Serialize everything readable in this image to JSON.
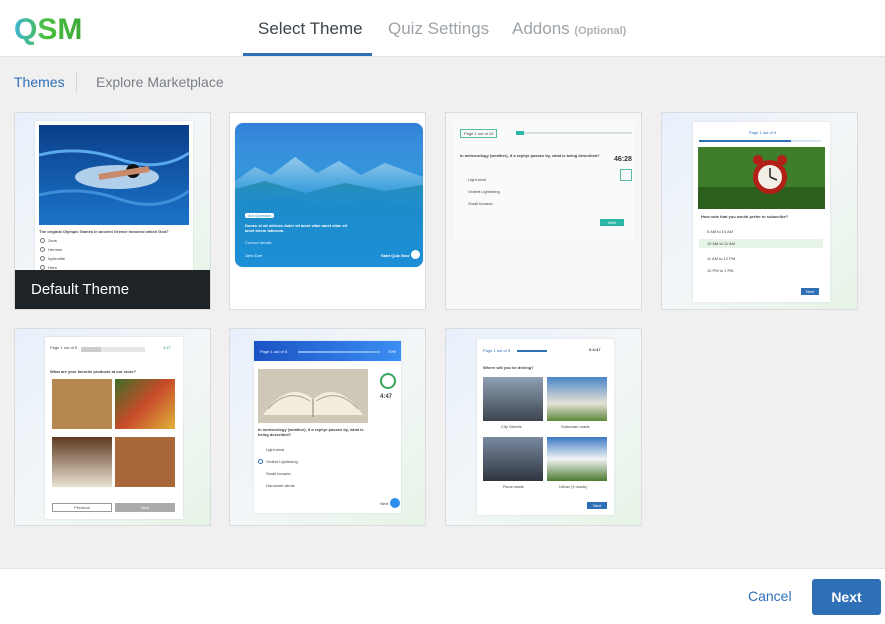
{
  "header": {
    "logo_text": "QSM",
    "steps": [
      {
        "label": "Select Theme"
      },
      {
        "label": "Quiz Settings"
      },
      {
        "label": "Addons",
        "suffix": "(Optional)"
      }
    ]
  },
  "subnav": {
    "tabs": [
      {
        "label": "Themes"
      },
      {
        "label": "Explore Marketplace"
      }
    ]
  },
  "themes": [
    {
      "label": "Default Theme",
      "question": "The original Olympic Games in ancient Greece honored which God?",
      "options": [
        "Zeus",
        "Hermes",
        "Aphrodite",
        "Hera"
      ]
    },
    {
      "badge": "3rd Question",
      "question": "Donec et sit ultrices dolor sit amet vitae amet vitae sit amet lorem laborum.",
      "sub": "Contact details",
      "name": "John Doe",
      "cta": "Start Quiz Now"
    },
    {
      "page": "Page 1 out of 15",
      "question": "In meteorology (weather), if a zephyr passes by, what is being described?",
      "timer": "46:28",
      "options": [
        "Light wind",
        "Violent Lightening",
        "Small tornado"
      ],
      "next": "Next"
    },
    {
      "page": "Page 1 out of 5",
      "question": "How note that you would prefer to subscribe?",
      "options": [
        "5 AM to 10 AM",
        "10 AM to 11 AM",
        "11 AM to 12 PM",
        "12 PM to 1 PM"
      ],
      "next": "Next"
    },
    {
      "page": "Page 1 out of 5",
      "timer": "4:47",
      "question": "What are your favorite products at our store?",
      "prev": "Previous",
      "next": "Next"
    },
    {
      "page": "Page 1 out of 5",
      "percent": "70%",
      "question": "In meteorology (weather), if a zephyr passes by, what is being described?",
      "timer": "4:47",
      "options": [
        "Light wind",
        "Violent Lightening",
        "Small tornado",
        "Hurricane winds"
      ],
      "next": "Next"
    },
    {
      "page": "Page 1 out of 5",
      "timer": "0:4:47",
      "question": "Where will you be driving?",
      "captions": [
        "City Streets",
        "Suburban roads",
        "Rural roads",
        "Urban (3 roads)"
      ],
      "next": "Next"
    }
  ],
  "footer": {
    "cancel": "Cancel",
    "next": "Next"
  },
  "colors": {
    "accent": "#2e6fb7",
    "logo_green": "#4cbf40",
    "dark_label": "#1d2327"
  }
}
